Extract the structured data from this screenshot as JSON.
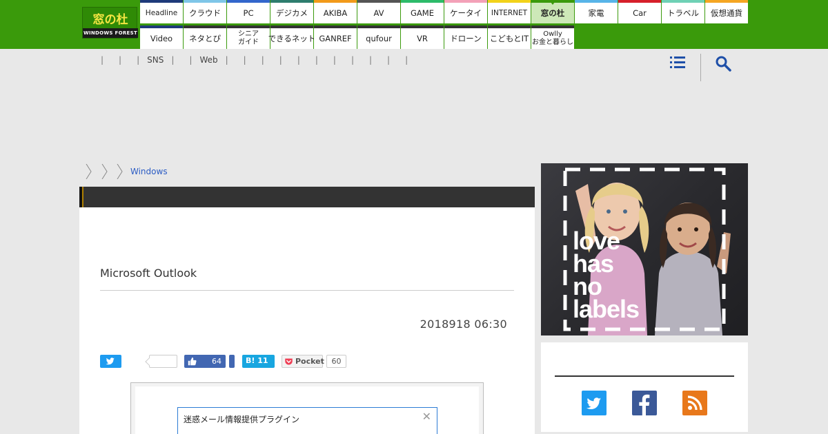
{
  "logo": {
    "name_jp": "窓の杜",
    "name_en": "WINDOWS FOREST"
  },
  "sites": [
    {
      "label": "Headline",
      "color": "#1e3a7a"
    },
    {
      "label": "クラウド",
      "color": "#7fc6e8"
    },
    {
      "label": "PC",
      "color": "#3366cc"
    },
    {
      "label": "デジカメ",
      "color": "#2e7d6e"
    },
    {
      "label": "AKIBA",
      "color": "#f29a1a"
    },
    {
      "label": "AV",
      "color": "#555555"
    },
    {
      "label": "GAME",
      "color": "#2dbb6a"
    },
    {
      "label": "ケータイ",
      "color": "#f3a1b8"
    },
    {
      "label": "INTERNET",
      "color": "#f2d21a"
    },
    {
      "label": "窓の杜",
      "color": "#3a9a0b"
    },
    {
      "label": "家電",
      "color": "#58b4e8"
    },
    {
      "label": "Car",
      "color": "#d61f2b"
    },
    {
      "label": "トラベル",
      "color": "#6fd1b5"
    },
    {
      "label": "仮想通貨",
      "color": "#f5a623"
    },
    {
      "label": "Video",
      "color": "#1e3a7a"
    },
    {
      "label": "ネタとぴ",
      "color": "#333333"
    },
    {
      "label": "シニア\nガイド",
      "color": "#333333"
    },
    {
      "label": "できるネット",
      "color": "#333333"
    },
    {
      "label": "GANREF",
      "color": "#333333"
    },
    {
      "label": "qufour",
      "color": "#333333"
    },
    {
      "label": "VR",
      "color": "#333333"
    },
    {
      "label": "ドローン",
      "color": "#333333"
    },
    {
      "label": "こどもとIT",
      "color": "#333333"
    },
    {
      "label": "Owlly\nお金と暮らし",
      "color": "#333333"
    }
  ],
  "subnav": {
    "items": [
      "",
      "",
      "",
      "SNS",
      "",
      "Web",
      "",
      "",
      "",
      "",
      "",
      "",
      "",
      "",
      "",
      "",
      ""
    ]
  },
  "breadcrumb": {
    "link": "Windows"
  },
  "article": {
    "subtitle": "Microsoft Outlook",
    "date": "2018918 06:30",
    "fb_count": "64",
    "hatena_label": "B! 11",
    "pocket_label": "Pocket",
    "pocket_count": "60",
    "dialog_title": "迷惑メール情報提供プラグイン",
    "dialog_close": "✕"
  },
  "ad": {
    "text": "love\nhas\nno\nlabels"
  },
  "icons": {
    "menu": "hamburger-menu-icon",
    "search": "search-icon",
    "twitter": "twitter-icon",
    "facebook": "facebook-icon",
    "rss": "rss-icon"
  },
  "colors": {
    "brand_green": "#3a9a0b",
    "link_blue": "#2a5bc4",
    "twitter": "#1d9bf0",
    "facebook": "#3b5998",
    "rss": "#e8781b"
  }
}
